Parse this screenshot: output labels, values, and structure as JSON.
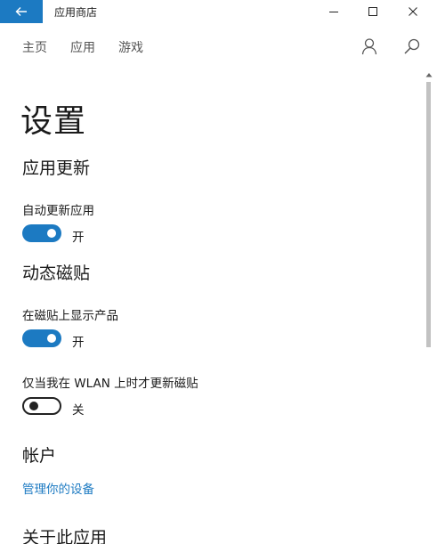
{
  "window": {
    "title": "应用商店",
    "accent": "#1c7ac2"
  },
  "nav": {
    "tabs": [
      "主页",
      "应用",
      "游戏"
    ]
  },
  "page": {
    "title": "设置"
  },
  "sections": {
    "app_updates": {
      "title": "应用更新",
      "auto_update": {
        "label": "自动更新应用",
        "state": "开",
        "on": true
      }
    },
    "live_tiles": {
      "title": "动态磁贴",
      "show_products": {
        "label": "在磁贴上显示产品",
        "state": "开",
        "on": true
      },
      "wlan_only": {
        "label": "仅当我在 WLAN 上时才更新磁贴",
        "state": "关",
        "on": false
      }
    },
    "account": {
      "title": "帐户",
      "manage_devices": "管理你的设备"
    },
    "about": {
      "title": "关于此应用"
    }
  }
}
